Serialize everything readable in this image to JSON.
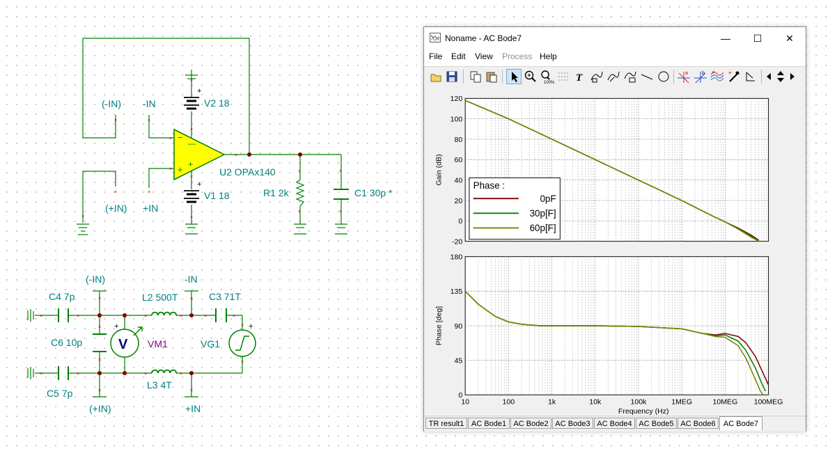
{
  "schematic": {
    "labels": {
      "neg_in_paren_top": "(-IN)",
      "neg_in_top": "-IN",
      "v2": "V2 18",
      "v1": "V1 18",
      "opamp": "U2 OPAx140",
      "pos_in_paren": "(+IN)",
      "pos_in": "+IN",
      "r1": "R1 2k",
      "c1": "C1 30p *",
      "neg_in_paren_bottom": "(-IN)",
      "neg_in_bottom": "-IN",
      "c4": "C4 7p",
      "l2": "L2 500T",
      "c3": "C3 71T",
      "c6": "C6 10p",
      "vm1": "VM1",
      "vg1": "VG1",
      "c5": "C5 7p",
      "l3": "L3 4T",
      "pos_in_paren_bottom": "(+IN)",
      "pos_in_bottom": "+IN",
      "plus_v2": "+",
      "plus_v1": "+",
      "plus_vm": "+",
      "plus_vg": "+",
      "minus_op": "−",
      "plus_op": "+",
      "v_letter": "V"
    },
    "colors": {
      "wire": "#007f00",
      "label": "#007f7f",
      "opamp_fill": "#ffff00",
      "node": "#7f0000",
      "vm_label": "#7f007f"
    }
  },
  "window": {
    "title": "Noname - AC Bode7",
    "controls": {
      "minimize": "—",
      "maximize": "☐",
      "close": "✕"
    },
    "menu": [
      "File",
      "Edit",
      "View",
      "Process",
      "Help"
    ],
    "menu_disabled": [
      "Process"
    ],
    "toolbar_icons": [
      "open-icon",
      "save-icon",
      "copy-icon",
      "paste-icon",
      "pointer-icon",
      "zoom-in-icon",
      "zoom-100-icon",
      "grid-icon",
      "text-icon",
      "curve-label-icon",
      "curve-label-2-icon",
      "curve-label-3-icon",
      "line-icon",
      "circle-icon",
      "cursor-a-icon",
      "cursor-b-icon",
      "curves-icon",
      "dropper-icon",
      "step-icon",
      "scroll-left-icon",
      "scroll-updown-icon",
      "scroll-right-icon"
    ],
    "tabs": [
      "TR result1",
      "AC Bode1",
      "AC Bode2",
      "AC Bode3",
      "AC Bode4",
      "AC Bode5",
      "AC Bode6",
      "AC Bode7"
    ],
    "active_tab": "AC Bode7"
  },
  "chart_data": [
    {
      "type": "line",
      "x_scale": "log",
      "xlim": [
        10,
        100000000
      ],
      "ylim": [
        -20,
        120
      ],
      "ylabel": "Gain (dB)",
      "yticks": [
        "120",
        "100",
        "80",
        "60",
        "40",
        "20",
        "0",
        "-20"
      ],
      "legend_title": "Phase :",
      "legend_position": "center-left",
      "series": [
        {
          "name": "0pF",
          "color": "#800000",
          "x": [
            10,
            100,
            1000,
            10000,
            100000,
            1000000,
            5000000,
            10000000,
            20000000,
            40000000,
            60000000
          ],
          "y": [
            118,
            100,
            80,
            60,
            40,
            20,
            5,
            -1,
            -7,
            -14,
            -19
          ]
        },
        {
          "name": "30p[F]",
          "color": "#008000",
          "x": [
            10,
            100,
            1000,
            10000,
            100000,
            1000000,
            5000000,
            10000000,
            20000000,
            40000000,
            60000000
          ],
          "y": [
            118,
            100,
            80,
            60,
            40,
            20,
            5,
            -1,
            -7.5,
            -15,
            -20
          ]
        },
        {
          "name": "60p[F]",
          "color": "#808000",
          "x": [
            10,
            100,
            1000,
            10000,
            100000,
            1000000,
            5000000,
            10000000,
            20000000,
            40000000,
            60000000
          ],
          "y": [
            118,
            100,
            80,
            60,
            40,
            20,
            5,
            -1,
            -8,
            -16,
            -20
          ]
        }
      ]
    },
    {
      "type": "line",
      "x_scale": "log",
      "xlim": [
        10,
        100000000
      ],
      "ylim": [
        0,
        180
      ],
      "ylabel": "Phase [deg]",
      "xlabel": "Frequency (Hz)",
      "yticks": [
        "180",
        "135",
        "90",
        "45",
        "0"
      ],
      "xticks": [
        "10",
        "100",
        "1k",
        "10k",
        "100k",
        "1MEG",
        "10MEG",
        "100MEG"
      ],
      "series": [
        {
          "name": "0pF",
          "color": "#800000",
          "x": [
            10,
            20,
            50,
            100,
            200,
            500,
            1000,
            10000,
            100000,
            1000000,
            3000000,
            6000000,
            10000000,
            20000000,
            30000000,
            50000000,
            70000000,
            100000000
          ],
          "y": [
            135,
            118,
            102,
            95,
            92,
            90,
            90,
            90,
            89,
            86,
            80,
            78,
            80,
            76,
            68,
            50,
            32,
            13
          ]
        },
        {
          "name": "30p[F]",
          "color": "#008000",
          "x": [
            10,
            20,
            50,
            100,
            200,
            500,
            1000,
            10000,
            100000,
            1000000,
            3000000,
            6000000,
            10000000,
            20000000,
            30000000,
            50000000,
            70000000,
            85000000
          ],
          "y": [
            135,
            118,
            102,
            95,
            92,
            90,
            90,
            90,
            89,
            86,
            80,
            77,
            78,
            70,
            58,
            35,
            15,
            5
          ]
        },
        {
          "name": "60p[F]",
          "color": "#808000",
          "x": [
            10,
            20,
            50,
            100,
            200,
            500,
            1000,
            10000,
            100000,
            1000000,
            3000000,
            6000000,
            10000000,
            20000000,
            30000000,
            50000000,
            65000000,
            75000000
          ],
          "y": [
            135,
            118,
            102,
            95,
            92,
            90,
            90,
            90,
            89,
            86,
            80,
            76,
            75,
            64,
            48,
            20,
            5,
            0
          ]
        }
      ]
    }
  ]
}
